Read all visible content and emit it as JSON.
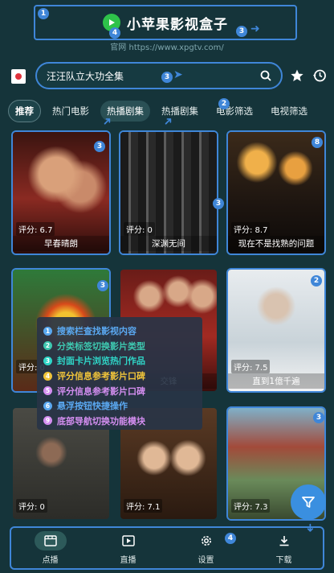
{
  "header": {
    "app_title": "小苹果影视盒子",
    "site_url": "官网 https://www.xpgtv.com/"
  },
  "search": {
    "value": "汪汪队立大功全集"
  },
  "tabs": [
    {
      "label": "推荐"
    },
    {
      "label": "热门电影"
    },
    {
      "label": "热播剧集"
    },
    {
      "label": "热播剧集"
    },
    {
      "label": "电影筛选"
    },
    {
      "label": "电视筛选"
    }
  ],
  "cards": [
    {
      "rating": "评分: 6.7",
      "title": "早春晴朗"
    },
    {
      "rating": "评分: 0",
      "title": "深渊无间"
    },
    {
      "rating": "评分: 8.7",
      "title": "现在不是找熟的问题"
    },
    {
      "rating": "评分: 0",
      "title": ""
    },
    {
      "rating": "",
      "title": "交锋"
    },
    {
      "rating": "评分: 7.5",
      "title": "直到1億千遍"
    },
    {
      "rating": "评分: 0",
      "title": ""
    },
    {
      "rating": "评分: 7.1",
      "title": ""
    },
    {
      "rating": "评分: 7.3",
      "title": ""
    }
  ],
  "legend": [
    {
      "num": "1",
      "text": "搜索栏查找影视内容",
      "color": "#5aa8f0"
    },
    {
      "num": "2",
      "text": "分类标签切换影片类型",
      "color": "#3ec8b0"
    },
    {
      "num": "3",
      "text": "封面卡片浏览热门作品",
      "color": "#2fd6c8"
    },
    {
      "num": "4",
      "text": "评分信息参考影片口碑",
      "color": "#f0c43a"
    },
    {
      "num": "5",
      "text": "评分信息参考影片口碑",
      "color": "#d48ef0"
    },
    {
      "num": "6",
      "text": "悬浮按钮快捷操作",
      "color": "#5aa8f0"
    },
    {
      "num": "9",
      "text": "底部导航切换功能模块",
      "color": "#d48ef0"
    }
  ],
  "markers": [
    "1",
    "4",
    "3",
    "3",
    "2",
    "3",
    "2",
    "3",
    "8",
    "3",
    "4",
    "2",
    "3",
    "4"
  ],
  "bottom_nav": [
    {
      "label": "点播",
      "icon": "film-icon"
    },
    {
      "label": "直播",
      "icon": "play-icon"
    },
    {
      "label": "设置",
      "icon": "gear-icon"
    },
    {
      "label": "下载",
      "icon": "download-icon"
    }
  ],
  "colors": {
    "background": "#15343a",
    "highlight_border": "#3f86d8",
    "fab": "#3a8fe0"
  }
}
